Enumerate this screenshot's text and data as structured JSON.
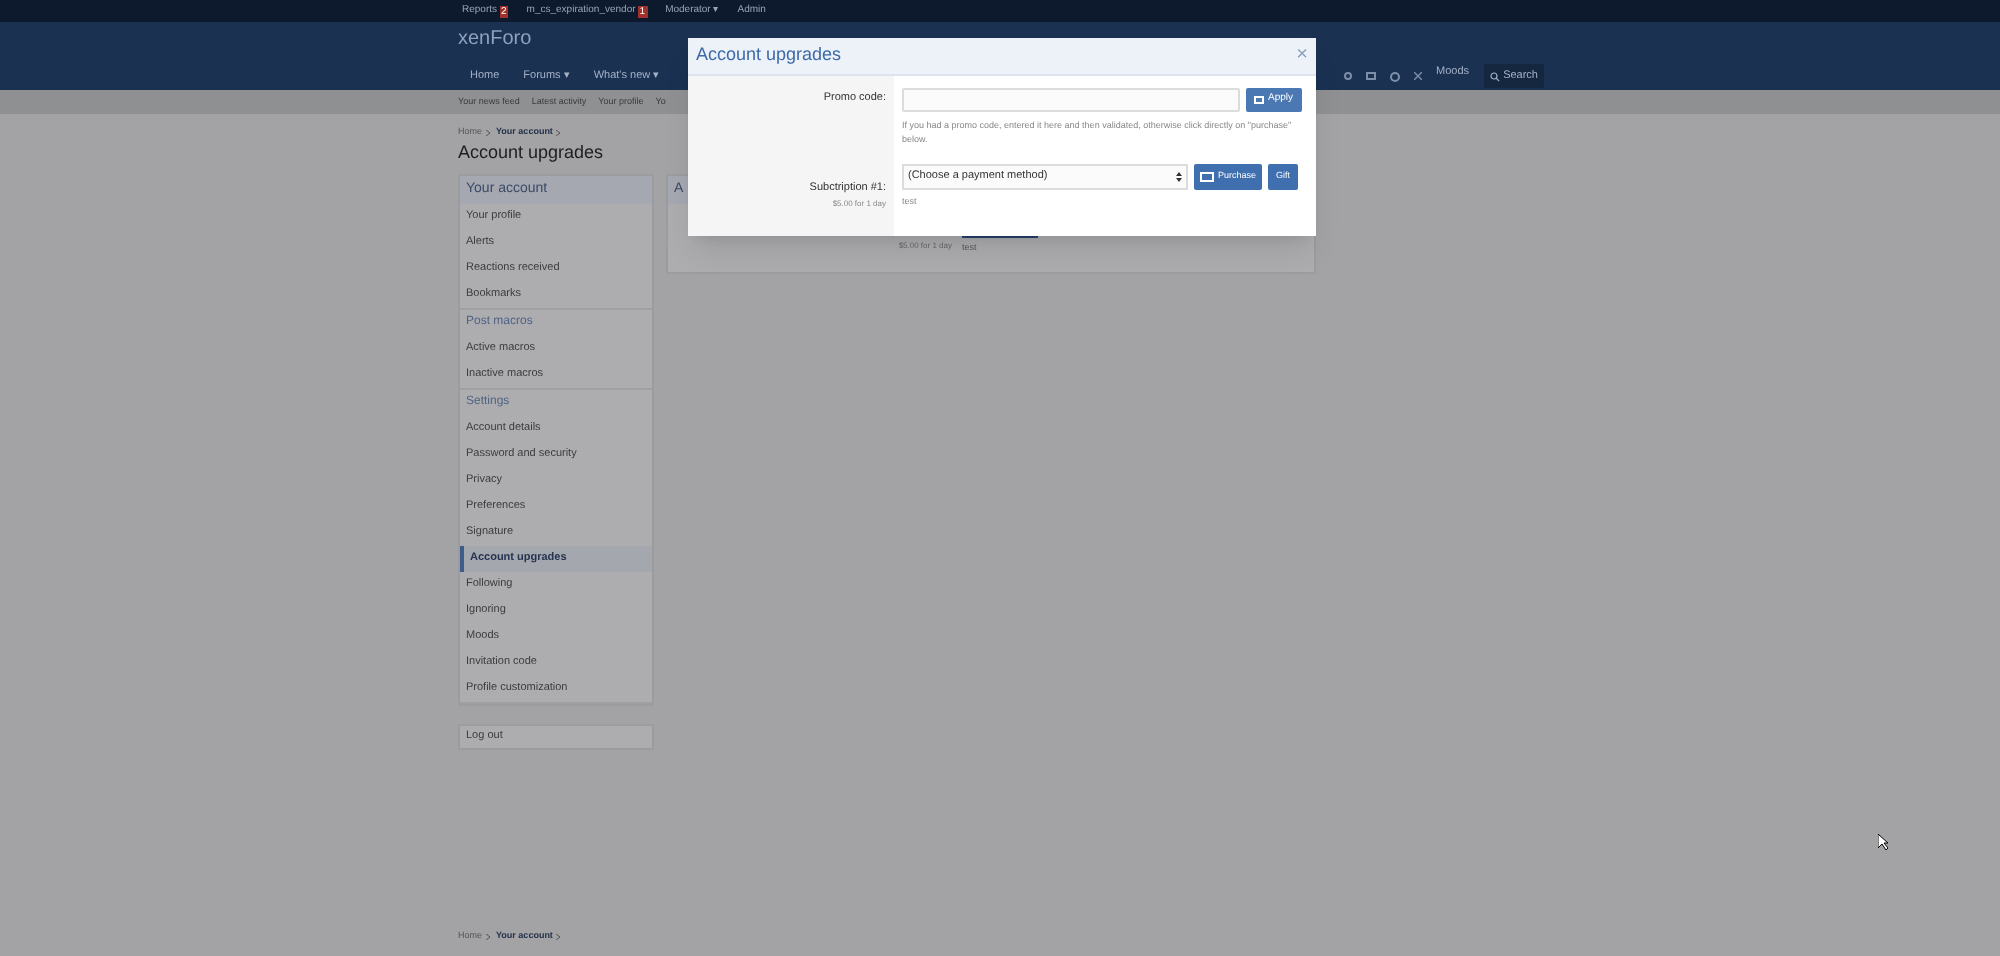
{
  "top_bar": {
    "items": [
      {
        "label": "Reports",
        "badge": "2"
      },
      {
        "label": "m_cs_expiration_vendor",
        "badge": "1"
      },
      {
        "label": "Moderator ▾"
      },
      {
        "label": "Admin"
      }
    ]
  },
  "header": {
    "logo": "xenForo"
  },
  "nav": {
    "tabs": [
      {
        "label": "Home",
        "selected": false
      },
      {
        "label": "Forums ▾",
        "selected": false
      },
      {
        "label": "What's new ▾",
        "selected": false
      }
    ],
    "moods": "Moods",
    "search": "Search"
  },
  "sub_nav": [
    "Your news feed",
    "Latest activity",
    "Your profile",
    "Yo"
  ],
  "breadcrumb": [
    "Home",
    "Your account"
  ],
  "page_title": "Account upgrades",
  "sidebar": {
    "sections": [
      {
        "title": "Your account",
        "kind": "header",
        "items": [
          {
            "label": "Your profile",
            "selected": false
          },
          {
            "label": "Alerts",
            "selected": false
          },
          {
            "label": "Reactions received",
            "selected": false
          },
          {
            "label": "Bookmarks",
            "selected": false
          }
        ]
      },
      {
        "title": "Post macros",
        "kind": "subheader",
        "items": [
          {
            "label": "Active macros",
            "selected": false
          },
          {
            "label": "Inactive macros",
            "selected": false
          }
        ]
      },
      {
        "title": "Settings",
        "kind": "subheader",
        "items": [
          {
            "label": "Account details",
            "selected": false
          },
          {
            "label": "Password and security",
            "selected": false
          },
          {
            "label": "Privacy",
            "selected": false
          },
          {
            "label": "Preferences",
            "selected": false
          },
          {
            "label": "Signature",
            "selected": false
          },
          {
            "label": "Account upgrades",
            "selected": true
          },
          {
            "label": "Following",
            "selected": false
          },
          {
            "label": "Ignoring",
            "selected": false
          },
          {
            "label": "Moods",
            "selected": false
          },
          {
            "label": "Invitation code",
            "selected": false
          },
          {
            "label": "Profile customization",
            "selected": false
          }
        ]
      }
    ],
    "logout": "Log out"
  },
  "background_panel": {
    "title": "A",
    "price": "$5.00 for 1 day",
    "note": "test"
  },
  "footer_breadcrumb": [
    "Home",
    "Your account"
  ],
  "modal": {
    "title": "Account upgrades",
    "close": "×",
    "promo_label": "Promo code:",
    "apply": "Apply",
    "promo_hint": "If you had a promo code, entered it here and then validated, otherwise click directly on \"purchase\" below.",
    "subscription_label": "Subctription #1:",
    "subscription_price": "$5.00 for 1 day",
    "payment_select": "(Choose a payment method)",
    "purchase": "Purchase",
    "gift": "Gift",
    "subscription_note": "test"
  }
}
